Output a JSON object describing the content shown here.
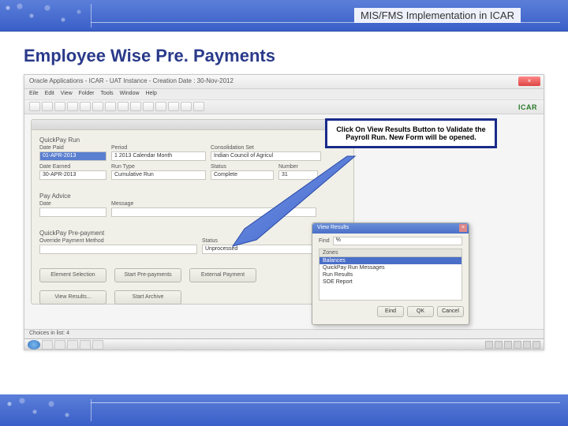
{
  "header": {
    "title": "MIS/FMS Implementation in ICAR"
  },
  "slide": {
    "title": "Employee Wise Pre. Payments"
  },
  "oracle": {
    "window_title": "Oracle Applications - ICAR - UAT Instance - Creation Date : 30-Nov-2012",
    "logo": "ICAR",
    "menus": [
      "Eile",
      "Edit",
      "View",
      "Folder",
      "Tools",
      "Window",
      "Help"
    ],
    "statusbar": "Choices in list: 4"
  },
  "form": {
    "sections": {
      "quickpay_run": {
        "title": "QuickPay Run",
        "date_paid_label": "Date Paid",
        "date_paid": "01-APR-2013",
        "period_label": "Period",
        "period": "1 2013 Calendar Month",
        "conset_label": "Consolidation Set",
        "conset": "Indian Council of Agricul",
        "date_earned_label": "Date Earned",
        "date_earned": "30-APR-2013",
        "runtype_label": "Run Type",
        "runtype": "Cumulative Run",
        "status_label": "Status",
        "status": "Complete",
        "number_label": "Number",
        "number": "31"
      },
      "pay_advice": {
        "title": "Pay Advice",
        "date_label": "Date",
        "date": "",
        "message_label": "Message",
        "message": ""
      },
      "prepayment": {
        "title": "QuickPay Pre-payment",
        "override_label": "Override Payment Method",
        "override": "",
        "status_label": "Status",
        "status": "Unprocessed"
      }
    },
    "buttons": {
      "element_selection": "Element Selection",
      "start_prepayments": "Start Pre-payments",
      "external_payment": "External Payment",
      "view_results": "View Results...",
      "start_archive": "Start Archive"
    }
  },
  "popup": {
    "title": "View Results",
    "find_label": "Find",
    "find_value": "%",
    "list_header": "Zones",
    "items": [
      "Balances",
      "QuickPay Run Messages",
      "Run Results",
      "SOE Report"
    ],
    "selected_index": 0,
    "buttons": {
      "find": "Eind",
      "ok": "QK",
      "cancel": "Cancel"
    }
  },
  "callout": {
    "text": "Click On View Results Button to Validate the Payroll Run. New Form will be opened."
  }
}
